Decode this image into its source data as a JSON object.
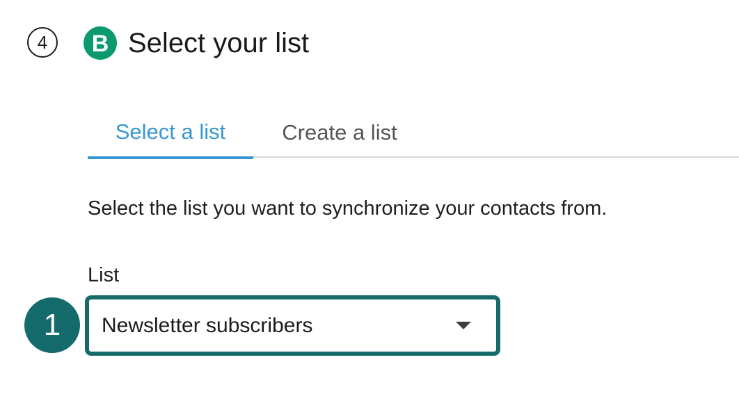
{
  "step": {
    "number": "4",
    "brand_logo_letter": "B",
    "brand_logo_icon": "brevo-logo-icon",
    "brand_color": "#0b9a6d",
    "title": "Select your list"
  },
  "tabs": [
    {
      "label": "Select a list",
      "active": true
    },
    {
      "label": "Create a list",
      "active": false
    }
  ],
  "colors": {
    "accent": "#3597d3",
    "highlight": "#156b6b",
    "tab_inactive": "#555555"
  },
  "description": "Select the list you want to synchronize your contacts from.",
  "list_field": {
    "label": "List",
    "selected_value": "Newsletter subscribers",
    "caret_icon": "caret-down-icon"
  },
  "annotation": {
    "marker_label": "1"
  }
}
